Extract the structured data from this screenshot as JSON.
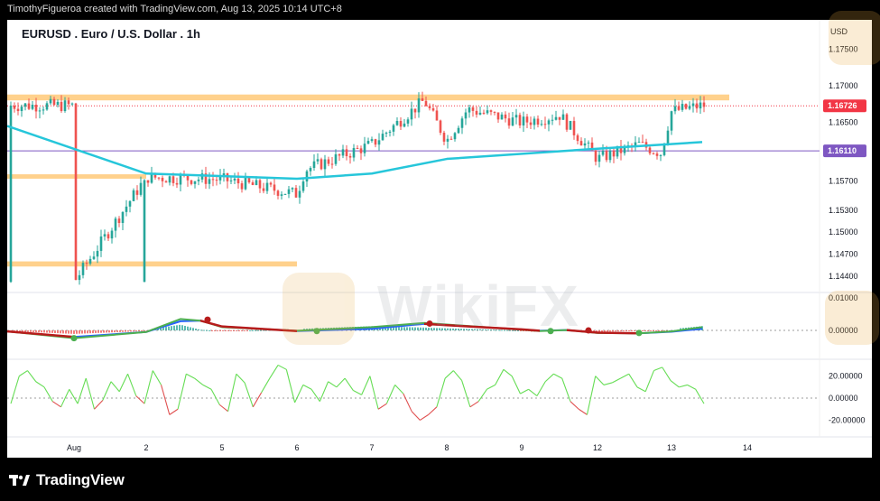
{
  "header": {
    "credit": "TimothyFigueroa created with TradingView.com, Aug 13, 2025 10:14 UTC+8"
  },
  "symbol": {
    "title": "EURUSD . Euro / U.S. Dollar . 1h",
    "currency": "USD"
  },
  "footer": {
    "brand": "TradingView",
    "logo_icon": "tradingview-logo-icon"
  },
  "watermark": {
    "text": "WikiFX",
    "icon": "wikifx-logo-icon"
  },
  "colors": {
    "up": "#26a69a",
    "down": "#ef5350",
    "ema": "#26c6da",
    "resistance": "#ffcc80",
    "support_line": "#7e57c2",
    "last_price": "#f23645",
    "level_badge": "#7e57c2",
    "macd_fast": "#4caf50",
    "macd_slow_up": "#2962ff",
    "macd_slow_down": "#b71c1c",
    "osc_up": "#66dd55",
    "osc_down": "#e05050"
  },
  "chart_data": [
    {
      "type": "candlestick",
      "name": "EURUSD 1h",
      "x_ticks": [
        "Aug",
        "2",
        "5",
        "6",
        "7",
        "8",
        "9",
        "12",
        "13",
        "14"
      ],
      "price_ticks": [
        "1.17500",
        "1.17000",
        "1.16500",
        "1.15700",
        "1.15300",
        "1.15000",
        "1.14700",
        "1.14400"
      ],
      "ylim": [
        1.142,
        1.179
      ],
      "last_price": "1.16726",
      "level_label": "1.16110",
      "level_value": 1.1611,
      "resistance_zones": [
        {
          "y_low": 1.168,
          "y_high": 1.1688,
          "x_from": "start",
          "x_to": "13"
        },
        {
          "y_low": 1.1573,
          "y_high": 1.1579,
          "x_from": "start",
          "x_to": "2"
        },
        {
          "y_low": 1.1453,
          "y_high": 1.146,
          "x_from": "start",
          "x_to": "6"
        }
      ],
      "anchors": [
        [
          "Aug",
          1.1432
        ],
        [
          "2",
          1.1575
        ],
        [
          "5",
          1.1572
        ],
        [
          "6",
          1.1552
        ],
        [
          "6.4",
          1.1585
        ],
        [
          "7",
          1.162
        ],
        [
          "7.6",
          1.168
        ],
        [
          "8",
          1.1625
        ],
        [
          "8.3",
          1.1668
        ],
        [
          "9",
          1.165
        ],
        [
          "9.5",
          1.166
        ],
        [
          "12",
          1.16
        ],
        [
          "12.5",
          1.162
        ],
        [
          "12.9",
          1.1608
        ],
        [
          "13",
          1.1665
        ],
        [
          "13.5",
          1.1673
        ]
      ],
      "ema": [
        [
          "start",
          1.1645
        ],
        [
          "2",
          1.158
        ],
        [
          "6",
          1.1573
        ],
        [
          "7",
          1.158
        ],
        [
          "8",
          1.16
        ],
        [
          "12",
          1.1614
        ],
        [
          "13.5",
          1.1623
        ]
      ]
    },
    {
      "type": "line",
      "name": "MACD",
      "ticks": [
        "0.01000",
        "0.00000"
      ],
      "fast": [
        [
          "start",
          -0.0003
        ],
        [
          "Aug",
          -0.0024
        ],
        [
          "2",
          -0.0005
        ],
        [
          "3",
          0.0035
        ],
        [
          "4",
          0.003
        ],
        [
          "5",
          0.001
        ],
        [
          "6",
          -0.0001
        ],
        [
          "7",
          0.001
        ],
        [
          "7.6",
          0.0023
        ],
        [
          "8",
          0.0018
        ],
        [
          "9",
          0.0002
        ],
        [
          "10",
          -0.0002
        ],
        [
          "11",
          0.0001
        ],
        [
          "12",
          -0.0008
        ],
        [
          "12.5",
          -0.0009
        ],
        [
          "13",
          -0.0003
        ],
        [
          "13.5",
          0.001
        ]
      ],
      "slow": [
        [
          "start",
          -0.0003
        ],
        [
          "Aug",
          -0.002
        ],
        [
          "2",
          -0.0005
        ],
        [
          "3",
          0.0028
        ],
        [
          "4",
          0.003
        ],
        [
          "5",
          0.0012
        ],
        [
          "6",
          -0.0002
        ],
        [
          "7",
          0.0005
        ],
        [
          "7.6",
          0.002
        ],
        [
          "8",
          0.0016
        ],
        [
          "9",
          0.0003
        ],
        [
          "10",
          -0.0001
        ],
        [
          "11",
          0.0001
        ],
        [
          "12",
          -0.0007
        ],
        [
          "12.5",
          -0.0009
        ],
        [
          "13",
          -0.0004
        ],
        [
          "13.5",
          0.0005
        ]
      ]
    },
    {
      "type": "line",
      "name": "Oscillator",
      "ticks": [
        "20.00000",
        "0.00000",
        "-20.00000"
      ],
      "ylim": [
        -27,
        32
      ],
      "zero": 0,
      "values": [
        -5,
        20,
        25,
        15,
        10,
        -3,
        -8,
        8,
        -5,
        18,
        -10,
        -2,
        15,
        6,
        22,
        2,
        -5,
        25,
        12,
        -15,
        -10,
        22,
        18,
        12,
        8,
        -6,
        -12,
        22,
        14,
        -8,
        5,
        18,
        30,
        26,
        -4,
        12,
        8,
        -3,
        15,
        10,
        18,
        7,
        3,
        20,
        -10,
        -5,
        12,
        4,
        -12,
        -20,
        -15,
        -8,
        18,
        25,
        16,
        -8,
        -3,
        8,
        12,
        26,
        20,
        4,
        8,
        2,
        15,
        22,
        18,
        -3,
        -10,
        -15,
        20,
        12,
        14,
        18,
        22,
        10,
        6,
        25,
        28,
        16,
        10,
        12,
        8,
        -5
      ]
    }
  ],
  "macd_markers": [
    {
      "x": "4.6",
      "y": 0.0033,
      "color": "#b71c1c"
    },
    {
      "x": "Aug",
      "y": -0.0024,
      "color": "#4caf50"
    },
    {
      "x": "6.3",
      "y": -0.0002,
      "color": "#4caf50"
    },
    {
      "x": "7.8",
      "y": 0.0021,
      "color": "#b71c1c"
    },
    {
      "x": "9.4",
      "y": -0.0002,
      "color": "#4caf50"
    },
    {
      "x": "10.9",
      "y": 0.0,
      "color": "#b71c1c"
    },
    {
      "x": "12.5",
      "y": -0.0008,
      "color": "#4caf50"
    }
  ]
}
